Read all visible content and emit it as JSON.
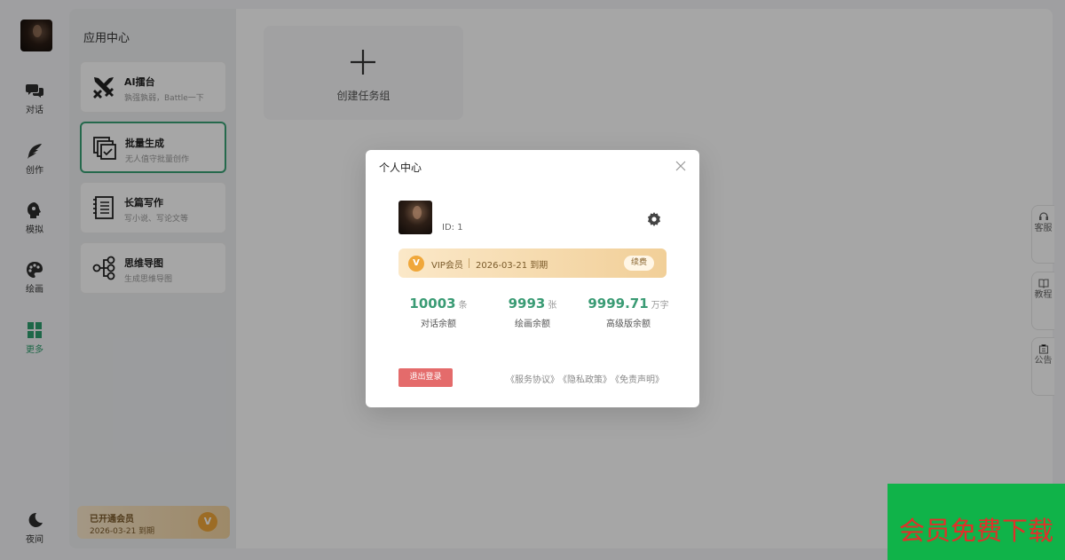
{
  "rail": {
    "items": [
      {
        "label": "对话",
        "icon": "chat-bubbles-icon"
      },
      {
        "label": "创作",
        "icon": "feather-icon"
      },
      {
        "label": "模拟",
        "icon": "mask-head-icon"
      },
      {
        "label": "绘画",
        "icon": "palette-icon"
      },
      {
        "label": "更多",
        "icon": "grid-icon"
      }
    ],
    "night_label": "夜间"
  },
  "app_center": {
    "title": "应用中心",
    "cards": [
      {
        "title": "AI擂台",
        "subtitle": "孰强孰弱，Battle一下",
        "icon": "crossed-swords-icon"
      },
      {
        "title": "批量生成",
        "subtitle": "无人值守批量创作",
        "icon": "batch-copy-icon"
      },
      {
        "title": "长篇写作",
        "subtitle": "写小说、写论文等",
        "icon": "notebook-icon"
      },
      {
        "title": "思维导图",
        "subtitle": "生成思维导图",
        "icon": "mindmap-icon"
      }
    ],
    "member": {
      "title": "已开通会员",
      "date": "2026-03-21 到期"
    }
  },
  "main": {
    "create_label": "创建任务组"
  },
  "side_tabs": [
    {
      "label": "客服",
      "icon": "headset-icon"
    },
    {
      "label": "教程",
      "icon": "book-icon"
    },
    {
      "label": "公告",
      "icon": "notice-icon"
    }
  ],
  "modal": {
    "title": "个人中心",
    "user_id": "ID: 1",
    "vip": {
      "label": "VIP会员",
      "expiry": "2026-03-21 到期",
      "renew": "续费",
      "badge": "V"
    },
    "stats": [
      {
        "value": "10003",
        "unit": "条",
        "label": "对话余额"
      },
      {
        "value": "9993",
        "unit": "张",
        "label": "绘画余额"
      },
      {
        "value": "9999.71",
        "unit": "万字",
        "label": "高级版余额"
      }
    ],
    "logout": "退出登录",
    "links": [
      "《服务协议》",
      "《隐私政策》",
      "《免责声明》"
    ]
  },
  "watermark": "会员免费下载",
  "colors": {
    "accent": "#3a9b74",
    "danger": "#e46b6b",
    "vip_gold": "#f0a73a",
    "watermark_bg": "#10b349",
    "watermark_text": "#e0302a"
  }
}
